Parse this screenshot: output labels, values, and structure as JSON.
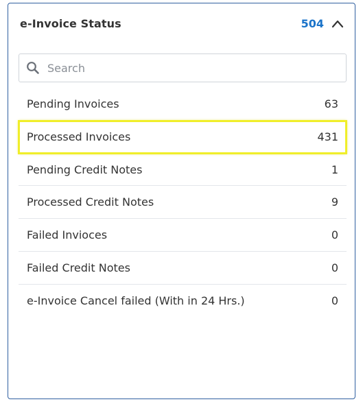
{
  "panel": {
    "title": "e-Invoice Status",
    "total": "504",
    "collapse_icon": "chevron-up-icon"
  },
  "search": {
    "placeholder": "Search",
    "value": "",
    "icon": "search-icon"
  },
  "items": [
    {
      "label": "Pending Invoices",
      "count": "63"
    },
    {
      "label": "Processed Invoices",
      "count": "431",
      "highlighted": true
    },
    {
      "label": "Pending Credit Notes",
      "count": "1"
    },
    {
      "label": "Processed Credit Notes",
      "count": "9"
    },
    {
      "label": "Failed Invioces",
      "count": "0"
    },
    {
      "label": "Failed Credit Notes",
      "count": "0"
    },
    {
      "label": "e-Invoice Cancel failed (With in 24 Hrs.)",
      "count": "0"
    }
  ],
  "colors": {
    "accent": "#1a73c9",
    "border": "#2f5fa0",
    "highlight": "#f0ee2a"
  }
}
